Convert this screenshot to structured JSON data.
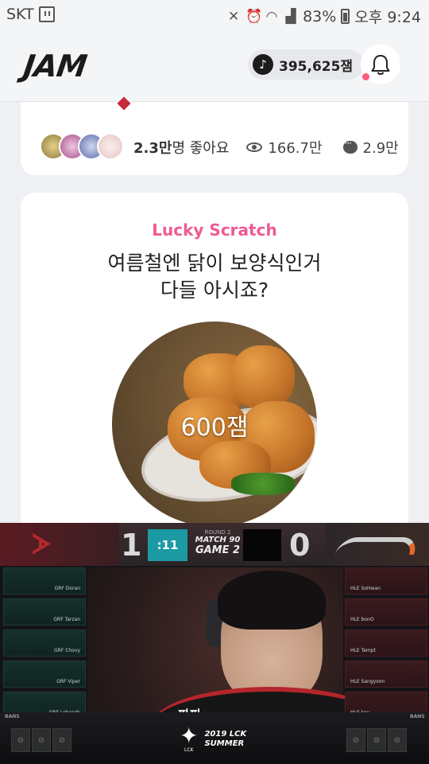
{
  "status": {
    "carrier": "SKT",
    "battery": "83%",
    "time": "오후 9:24",
    "icons": [
      "twitch-icon",
      "mute-icon",
      "alarm-icon",
      "wifi-icon",
      "signal-icon",
      "battery-icon"
    ]
  },
  "header": {
    "logo": "JAM",
    "points": "395,625잼",
    "points_icon": "music-note-icon",
    "bell_icon": "bell-icon",
    "notification_dot_color": "#ff5b7f"
  },
  "post": {
    "likes_count": "2.3만",
    "likes_suffix": "명 좋아요",
    "views": "166.7만",
    "comments": "2.9만",
    "avatar_colors": [
      "#c9b46a",
      "#c77ab3",
      "#7e8fc9",
      "#f0d8d8"
    ]
  },
  "promo": {
    "tag": "Lucky Scratch",
    "tag_color": "#ee5a93",
    "headline_line1": "여름철엔 닭이 보양식인거",
    "headline_line2": "다들 아시죠?",
    "prize_label": "600잼"
  },
  "video": {
    "score_left": "1",
    "score_right": "0",
    "timer": ":11",
    "round": "ROUND 2",
    "match": "MATCH 90",
    "game": "GAME 2",
    "team_left_players": [
      "GRF Doran",
      "GRF Tarzan",
      "GRF Chovy",
      "GRF Viper",
      "GRF Lehends"
    ],
    "team_right_players": [
      "HLE SoHwan",
      "HLE bonO",
      "HLE Tempt",
      "HLE Sangyoon",
      "HLE key"
    ],
    "bans_label": "BANS",
    "jersey_text": "파파",
    "league_year": "2019 LCK",
    "league_season": "SUMMER",
    "league_short": "LCK"
  }
}
